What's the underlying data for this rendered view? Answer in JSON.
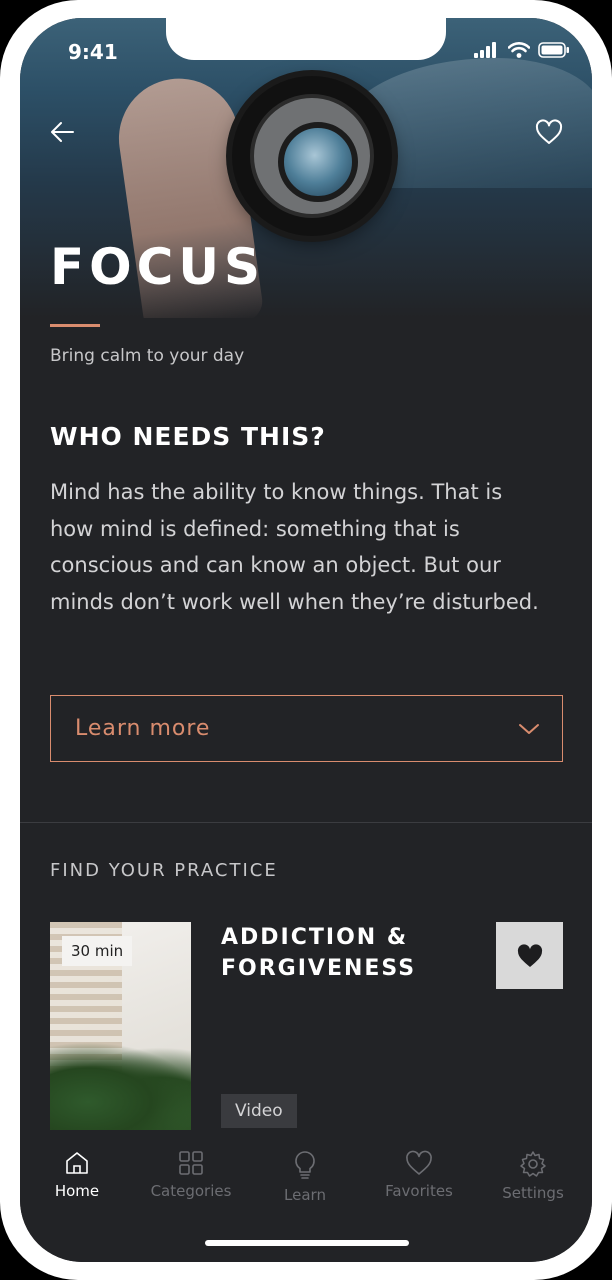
{
  "status_bar": {
    "time": "9:41",
    "icons": [
      "signal-icon",
      "wifi-icon",
      "battery-icon"
    ]
  },
  "header": {
    "back_icon": "arrow-left-icon",
    "favorite_icon": "heart-outline-icon"
  },
  "hero": {
    "title": "FOCUS",
    "subtitle": "Bring calm to your day"
  },
  "about": {
    "heading": "WHO NEEDS THIS?",
    "body": "Mind has the ability to know things. That is how mind is defined: something that is conscious and can know an object. But our minds don’t work well when they’re disturbed.",
    "learn_more_label": "Learn more"
  },
  "practice": {
    "section_label": "FIND YOUR PRACTICE",
    "card": {
      "duration": "30 min",
      "title": "ADDICTION & FORGIVENESS",
      "type": "Video",
      "favorite_icon": "heart-filled-icon"
    }
  },
  "tabbar": {
    "tabs": [
      {
        "label": "Home",
        "icon": "home-icon",
        "active": true
      },
      {
        "label": "Categories",
        "icon": "grid-icon",
        "active": false
      },
      {
        "label": "Learn",
        "icon": "lightbulb-icon",
        "active": false
      },
      {
        "label": "Favorites",
        "icon": "heart-outline-icon",
        "active": false
      },
      {
        "label": "Settings",
        "icon": "gear-icon",
        "active": false
      }
    ]
  },
  "colors": {
    "background": "#222326",
    "accent": "#d98c6e",
    "text_primary": "#ffffff",
    "text_muted": "#6c6d72"
  }
}
